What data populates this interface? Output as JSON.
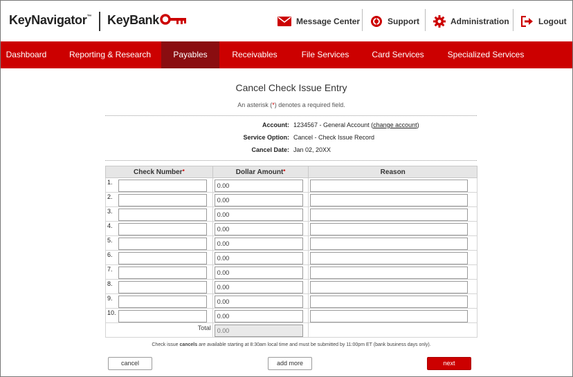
{
  "header": {
    "brand_keynavigator": "KeyNavigator",
    "brand_tm": "™",
    "brand_keybank": "KeyBank",
    "links": {
      "message_center": "Message Center",
      "support": "Support",
      "administration": "Administration",
      "logout": "Logout"
    }
  },
  "nav": {
    "items": [
      "Dashboard",
      "Reporting & Research",
      "Payables",
      "Receivables",
      "File Services",
      "Card Services",
      "Specialized Services"
    ],
    "active": "Payables"
  },
  "page": {
    "title": "Cancel Check Issue Entry",
    "subtitle_pre": "An asterisk (",
    "subtitle_star": "*",
    "subtitle_post": ") denotes a required field."
  },
  "info": {
    "account_label": "Account:",
    "account_value": "1234567 - General Account (",
    "change_account": "change account",
    "account_close": ")",
    "service_label": "Service Option:",
    "service_value": "Cancel - Check Issue Record",
    "date_label": "Cancel Date:",
    "date_value": "Jan 02, 20XX"
  },
  "table": {
    "col_check": "Check Number",
    "col_amount": "Dollar Amount",
    "col_reason": "Reason",
    "required_mark": "*",
    "rows": [
      {
        "num": "1.",
        "check": "",
        "amount": "0.00",
        "reason": ""
      },
      {
        "num": "2.",
        "check": "",
        "amount": "0.00",
        "reason": ""
      },
      {
        "num": "3.",
        "check": "",
        "amount": "0.00",
        "reason": ""
      },
      {
        "num": "4.",
        "check": "",
        "amount": "0.00",
        "reason": ""
      },
      {
        "num": "5.",
        "check": "",
        "amount": "0.00",
        "reason": ""
      },
      {
        "num": "6.",
        "check": "",
        "amount": "0.00",
        "reason": ""
      },
      {
        "num": "7.",
        "check": "",
        "amount": "0.00",
        "reason": ""
      },
      {
        "num": "8.",
        "check": "",
        "amount": "0.00",
        "reason": ""
      },
      {
        "num": "9.",
        "check": "",
        "amount": "0.00",
        "reason": ""
      },
      {
        "num": "10.",
        "check": "",
        "amount": "0.00",
        "reason": ""
      }
    ],
    "total_label": "Total",
    "total_value": "0.00"
  },
  "note": {
    "pre": "Check issue ",
    "bold": "cancels",
    "post": " are available starting at 8:30am local time and must be submitted by 11:00pm ET (bank business days only)."
  },
  "buttons": {
    "cancel": "cancel",
    "add_more": "add more",
    "next": "next"
  },
  "colors": {
    "brand_red": "#cc0000",
    "nav_active": "#8a0d10"
  },
  "icons": {
    "message_center": "envelope-icon",
    "support": "lifebuoy-icon",
    "administration": "gear-icon",
    "logout": "logout-icon",
    "brand": "key-icon"
  }
}
